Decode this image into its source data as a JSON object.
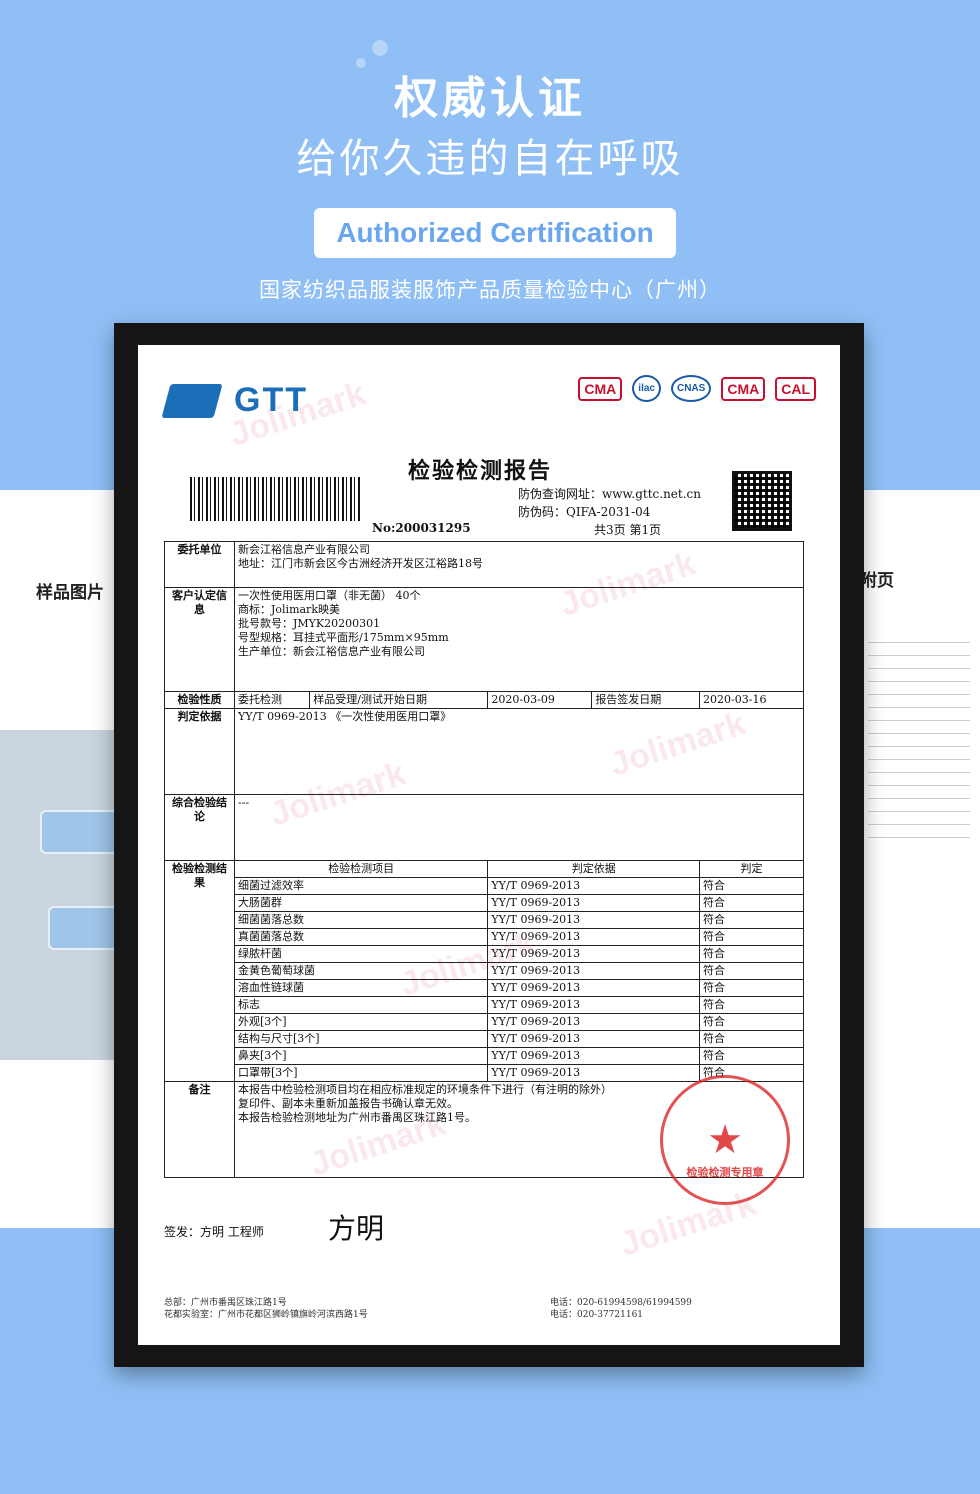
{
  "header": {
    "title": "权威认证",
    "subtitle": "给你久违的自在呼吸",
    "badge": "Authorized Certification",
    "org": "国家纺织品服装服饰产品质量检验中心（广州）"
  },
  "colors": {
    "background": "#8fbff5",
    "badge_text": "#6aa6ee",
    "frame": "#151515",
    "gtt_blue": "#1a6fb8",
    "stamp_red": "#dc2828"
  },
  "left_page": {
    "title": "样品图片"
  },
  "right_page": {
    "title": "附页"
  },
  "report": {
    "brand": "GTT",
    "title": "检验检测报告",
    "query_url": "防伪查询网址：www.gttc.net.cn",
    "anti_fake_code": "防伪码：QIFA-2031-04",
    "report_no": "No:200031295",
    "pages": "共3页  第1页",
    "client_label": "委托单位",
    "client_name": "新会江裕信息产业有限公司",
    "client_addr": "地址：江门市新会区今古洲经济开发区江裕路18号",
    "sample_label": "客户认定信息",
    "sample_lines": [
      "一次性使用医用口罩（非无菌）        40个",
      "商标：Jolimark映美",
      "批号款号：JMYK20200301",
      "号型规格：耳挂式平面形/175mm×95mm",
      "生产单位：新会江裕信息产业有限公司"
    ],
    "nature_label": "检验性质",
    "nature": "委托检测",
    "recv_label": "样品受理/测试开始日期",
    "recv_date": "2020-03-09",
    "issue_label": "报告签发日期",
    "issue_date": "2020-03-16",
    "basis_label": "判定依据",
    "basis": "YY/T 0969-2013 《一次性使用医用口罩》",
    "conclusion_label": "综合检验结论",
    "conclusion": "---",
    "results_label": "检验检测结果",
    "results_headers": [
      "检验检测项目",
      "判定依据",
      "判定"
    ],
    "results": [
      [
        "细菌过滤效率",
        "YY/T 0969-2013",
        "符合"
      ],
      [
        "大肠菌群",
        "YY/T 0969-2013",
        "符合"
      ],
      [
        "细菌菌落总数",
        "YY/T 0969-2013",
        "符合"
      ],
      [
        "真菌菌落总数",
        "YY/T 0969-2013",
        "符合"
      ],
      [
        "绿脓杆菌",
        "YY/T 0969-2013",
        "符合"
      ],
      [
        "金黄色葡萄球菌",
        "YY/T 0969-2013",
        "符合"
      ],
      [
        "溶血性链球菌",
        "YY/T 0969-2013",
        "符合"
      ],
      [
        "标志",
        "YY/T 0969-2013",
        "符合"
      ],
      [
        "外观[3个]",
        "YY/T 0969-2013",
        "符合"
      ],
      [
        "结构与尺寸[3个]",
        "YY/T 0969-2013",
        "符合"
      ],
      [
        "鼻夹[3个]",
        "YY/T 0969-2013",
        "符合"
      ],
      [
        "口罩带[3个]",
        "YY/T 0969-2013",
        "符合"
      ]
    ],
    "remarks_label": "备注",
    "remarks": [
      "本报告中检验检测项目均在相应标准规定的环境条件下进行（有注明的除外）",
      "复印件、副本未重新加盖报告书确认章无效。",
      "本报告检验检测地址为广州市番禺区珠江路1号。"
    ],
    "signer": "签发：方明  工程师",
    "signature": "方明",
    "stamp_text": "检验检测专用章",
    "footer_left": [
      "总部：广州市番禺区珠江路1号",
      "花都实验室：广州市花都区狮岭镇旗岭河滨西路1号"
    ],
    "footer_right": [
      "电话：020-61994598/61994599",
      "电话：020-37721161"
    ],
    "watermark": "Jolimark"
  }
}
